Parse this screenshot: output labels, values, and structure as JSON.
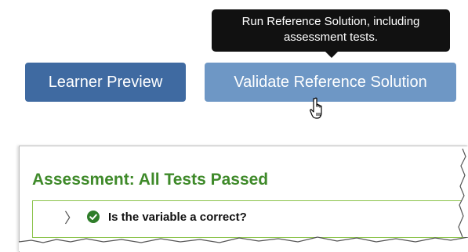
{
  "tooltip": {
    "line1": "Run Reference Solution, including",
    "line2": "assessment tests."
  },
  "buttons": {
    "learner_preview": "Learner Preview",
    "validate_reference": "Validate Reference Solution"
  },
  "assessment": {
    "title": "Assessment: All Tests Passed",
    "tests": [
      {
        "label": "Is the variable a correct?",
        "status": "passed"
      }
    ]
  },
  "colors": {
    "learner_button": "#3f6aa1",
    "validate_button": "#6e97c5",
    "success_green": "#3f8a2a",
    "tooltip_bg": "#111111"
  },
  "icons": {
    "cursor": "hand-pointer-icon",
    "expand": "chevron-right-icon",
    "status": "check-circle-icon"
  }
}
